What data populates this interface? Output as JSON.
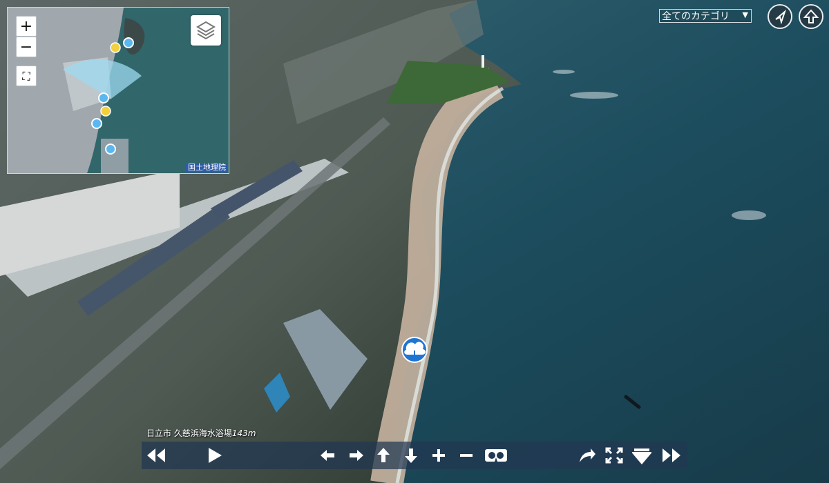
{
  "viewer": {
    "location_title": "日立市 久慈浜海水浴場",
    "altitude": "143m",
    "category_select": "全てのカテゴリ"
  },
  "map": {
    "zoom_in": "+",
    "zoom_out": "−",
    "credit": "国土地理院"
  },
  "colors": {
    "control_bar": "#213752",
    "marker_yellow": "#f2d13b",
    "marker_blue": "#5bb7f0",
    "cloud_marker": "#1f75d3"
  },
  "icons": {
    "rewind": "rewind-icon",
    "play": "play-icon",
    "left": "arrow-left-icon",
    "right": "arrow-right-icon",
    "up": "arrow-up-icon",
    "down": "arrow-down-icon",
    "zoom_in": "plus-icon",
    "zoom_out": "minus-icon",
    "vr": "vr-glasses-icon",
    "share": "share-icon",
    "fullscreen": "fullscreen-icon",
    "collapse": "collapse-icon",
    "forward": "fast-forward-icon"
  }
}
